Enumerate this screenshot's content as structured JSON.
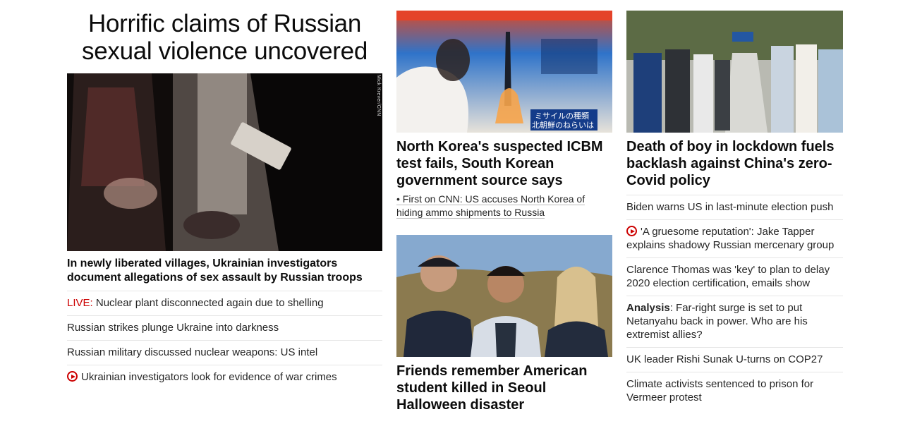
{
  "left": {
    "hero_headline": "Horrific claims of Russian sexual violence uncovered",
    "photo_credit": "Mick Krever/CNN",
    "lead_headline": "In newly liberated villages, Ukrainian investigators document allegations of sex assault by Russian troops",
    "stories": [
      {
        "tag": "LIVE:",
        "text": " Nuclear plant disconnected again due to shelling",
        "icon": ""
      },
      {
        "tag": "",
        "text": "Russian strikes plunge Ukraine into darkness",
        "icon": ""
      },
      {
        "tag": "",
        "text": "Russian military discussed nuclear weapons: US intel",
        "icon": ""
      },
      {
        "tag": "",
        "text": "Ukrainian investigators look for evidence of war crimes",
        "icon": "play-video-icon"
      }
    ]
  },
  "middle": {
    "korea_headline": "North Korea's suspected ICBM test fails, South Korean government source says",
    "korea_sub": "• First on CNN: US accuses North Korea of hiding ammo shipments to Russia",
    "friends_headline": "Friends remember American student killed in Seoul Halloween disaster",
    "korea_screen_text_1": "ミサイルの種類",
    "korea_screen_text_2": "北朝鮮のねらいは"
  },
  "right": {
    "china_headline": "Death of boy in lockdown fuels backlash against China's zero-Covid policy",
    "stories": [
      {
        "tag": "",
        "text": "Biden warns US in last-minute election push",
        "icon": ""
      },
      {
        "tag": "",
        "text": "'A gruesome reputation': Jake Tapper explains shadowy Russian mercenary group",
        "icon": "play-video-icon"
      },
      {
        "tag": "",
        "text": "Clarence Thomas was 'key' to plan to delay 2020 election certification, emails show",
        "icon": ""
      },
      {
        "tag": "Analysis",
        "text": ": Far-right surge is set to put Netanyahu back in power. Who are his extremist allies?",
        "icon": ""
      },
      {
        "tag": "",
        "text": "UK leader Rishi Sunak U-turns on COP27",
        "icon": ""
      },
      {
        "tag": "",
        "text": "Climate activists sentenced to prison for Vermeer protest",
        "icon": ""
      }
    ]
  },
  "colors": {
    "accent_red": "#cc0000",
    "text": "#0c0c0c",
    "divider": "#e6e6e6"
  }
}
